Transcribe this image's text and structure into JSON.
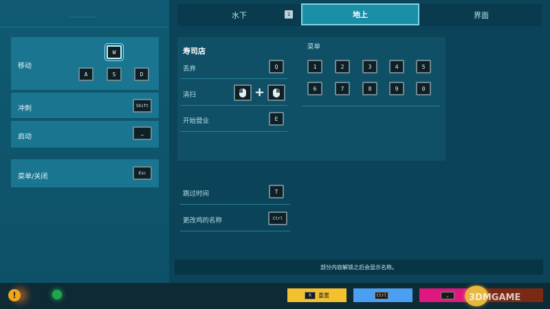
{
  "tabs": [
    {
      "label": "水下",
      "badge": "1"
    },
    {
      "label": "地上",
      "active": true
    },
    {
      "label": "界面"
    }
  ],
  "left": {
    "move_label": "移动",
    "move_keys": [
      "W",
      "A",
      "S",
      "D"
    ],
    "sprint_label": "冲刺",
    "sprint_key": "Shift",
    "launch_label": "启动",
    "launch_key": "⎵",
    "menu_close_label": "菜单/关闭",
    "menu_close_key": "Esc"
  },
  "sushi": {
    "title": "寿司店",
    "rows": [
      {
        "label": "丢弃",
        "key": "Q"
      },
      {
        "label": "清扫",
        "key": "mouse-left + mouse-right"
      },
      {
        "label": "开始营业",
        "key": "E"
      }
    ]
  },
  "menu": {
    "title": "菜单",
    "keys": [
      "1",
      "2",
      "3",
      "4",
      "5",
      "6",
      "7",
      "8",
      "9",
      "0"
    ]
  },
  "misc": [
    {
      "label": "跳过时间",
      "key": "T"
    },
    {
      "label": "更改鸡的名称",
      "key": "Ctrl"
    }
  ],
  "notice": "部分内容解锁之后会显示名称。",
  "bottom": {
    "reset_label": "重置",
    "reset_key": "R",
    "ctrl_key": "Ctrl",
    "space_key": "⎵",
    "warn_symbol": "!"
  },
  "watermark": "3DMGAME",
  "colors": {
    "accent": "#1a8ea7",
    "reset_button": "#f2c12e",
    "blue_button": "#4a9ff0",
    "pink_button": "#e0177e"
  }
}
